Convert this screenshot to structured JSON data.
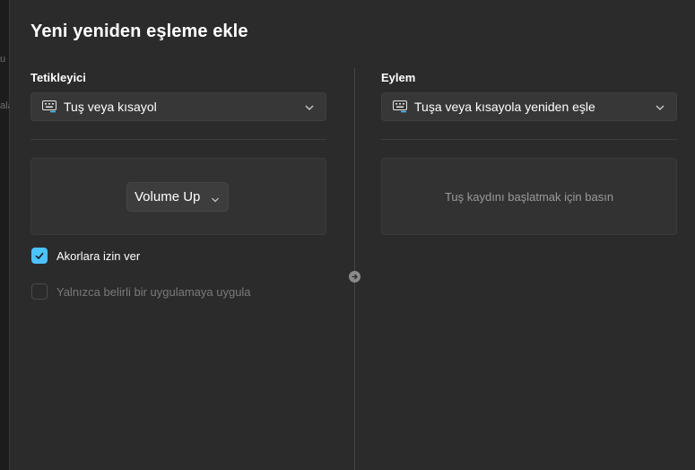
{
  "background_fragments": [
    "u",
    "ala"
  ],
  "dialog": {
    "title": "Yeni yeniden eşleme ekle"
  },
  "trigger": {
    "label": "Tetikleyici",
    "dropdown": {
      "icon": "keyboard-icon",
      "value": "Tuş veya kısayol"
    },
    "key": {
      "value": "Volume Up"
    },
    "options": [
      {
        "label": "Akorlara izin ver",
        "checked": true,
        "enabled": true
      },
      {
        "label": "Yalnızca belirli bir uygulamaya uygula",
        "checked": false,
        "enabled": false
      }
    ]
  },
  "action": {
    "label": "Eylem",
    "dropdown": {
      "icon": "keyboard-icon",
      "value": "Tuşa veya kısayola yeniden eşle"
    },
    "record_placeholder": "Tuş kaydını başlatmak için basın"
  },
  "colors": {
    "accent": "#4cc2ff",
    "dialog_bg": "#2b2b2b",
    "panel_bg": "#323232"
  }
}
